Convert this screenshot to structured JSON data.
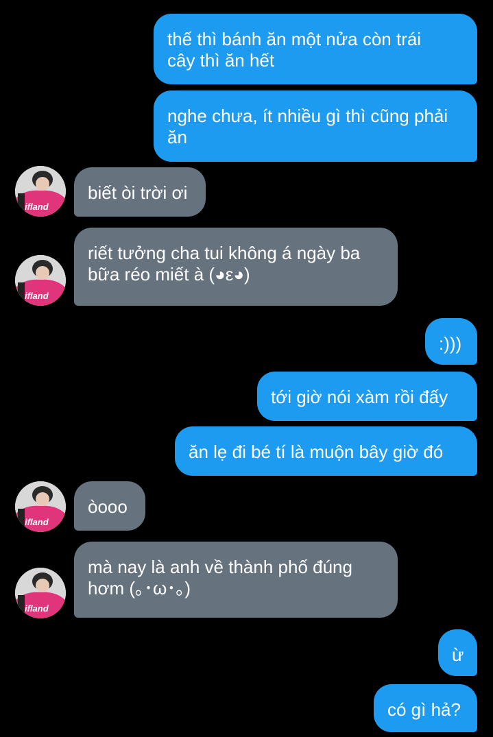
{
  "conversation": {
    "messages": [
      {
        "sender": "me",
        "text": "thế thì bánh ăn một nửa còn trái\ncây thì ăn hết"
      },
      {
        "sender": "me",
        "text": "nghe chưa, ít nhiều gì thì cũng phải\năn"
      },
      {
        "sender": "contact",
        "text": "biết òi trời ơi"
      },
      {
        "sender": "contact",
        "text": "riết tưởng cha tui không á ngày ba\nbữa réo miết à (◕ε◕)"
      },
      {
        "sender": "me",
        "text": ":)))"
      },
      {
        "sender": "me",
        "text": "tới giờ nói xàm rồi đấy"
      },
      {
        "sender": "me",
        "text": "ăn lẹ đi bé tí là muộn bây giờ đó"
      },
      {
        "sender": "contact",
        "text": "òooo"
      },
      {
        "sender": "contact",
        "text": "mà nay là anh về thành phố đúng\nhơm (｡･ω･｡)"
      },
      {
        "sender": "me",
        "text": "ừ"
      },
      {
        "sender": "me",
        "text": "có gì hả?"
      }
    ],
    "avatar_logo": "ifland"
  },
  "colors": {
    "background": "#000000",
    "outgoing_bubble": "#1d9bf0",
    "incoming_bubble": "#66727e",
    "text": "#ffffff",
    "avatar_jersey": "#e0357b"
  }
}
